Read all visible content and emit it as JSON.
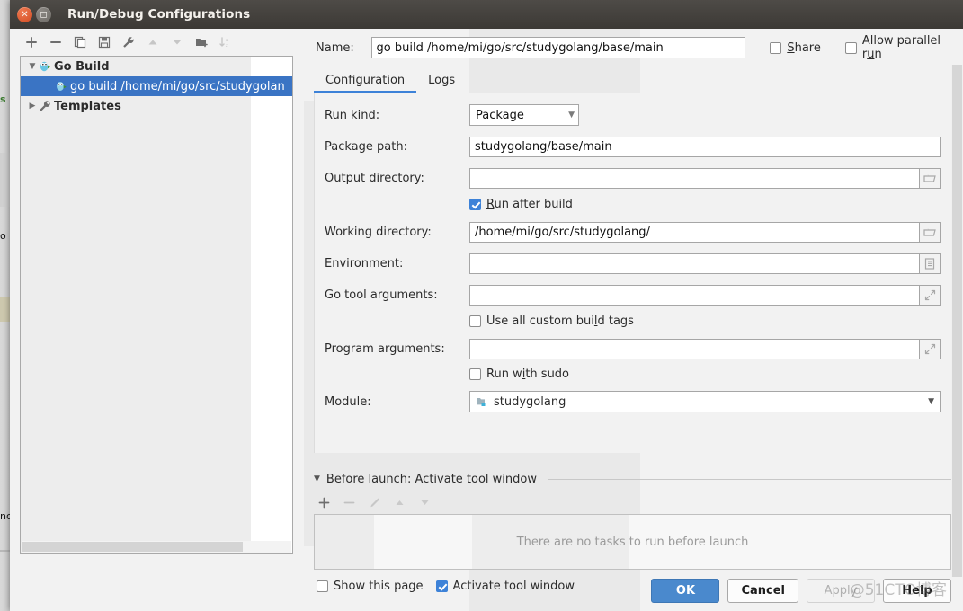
{
  "window": {
    "title": "Run/Debug Configurations",
    "close_icon": "close-icon",
    "maximize_icon": "maximize-icon"
  },
  "tree_toolbar": {
    "items": [
      {
        "icon": "plus-icon",
        "label": "+",
        "enabled": true
      },
      {
        "icon": "minus-icon",
        "label": "−",
        "enabled": true
      },
      {
        "icon": "copy-icon",
        "label": "Copy Configuration",
        "enabled": true
      },
      {
        "icon": "save-icon",
        "label": "Save Configuration",
        "enabled": true
      },
      {
        "icon": "wrench-icon",
        "label": "Edit Templates",
        "enabled": true
      },
      {
        "icon": "arrow-up-icon",
        "label": "Move Up",
        "enabled": false
      },
      {
        "icon": "arrow-down-icon",
        "label": "Move Down",
        "enabled": false
      },
      {
        "icon": "new-folder-icon",
        "label": "Create New Folder",
        "enabled": true
      },
      {
        "icon": "sort-alpha-icon",
        "label": "Sort Configurations",
        "enabled": false
      }
    ]
  },
  "tree": {
    "nodes": [
      {
        "label": "Go Build",
        "icon": "go-gopher-icon",
        "twisty": "▼",
        "level": 0,
        "selected": false
      },
      {
        "label": "go build /home/mi/go/src/studygolan",
        "icon": "go-run-icon",
        "twisty": "",
        "level": 1,
        "selected": true
      },
      {
        "label": "Templates",
        "icon": "wrench-icon",
        "twisty": "▶",
        "level": 0,
        "selected": false
      }
    ]
  },
  "name_row": {
    "label": "Name:",
    "value": "go build /home/mi/go/src/studygolang/base/main",
    "placeholder": "",
    "share": {
      "label": "Share",
      "mnemonic": "S",
      "checked": false
    },
    "allow_parallel": {
      "label": "Allow parallel run",
      "mnemonic": "u",
      "checked": false
    }
  },
  "tabs": [
    {
      "label": "Configuration",
      "active": true
    },
    {
      "label": "Logs",
      "active": false
    }
  ],
  "config": {
    "run_kind": {
      "label": "Run kind:",
      "value": "Package",
      "caret": "▼"
    },
    "package_path": {
      "label": "Package path:",
      "value": "studygolang/base/main",
      "spell_error": "studygolang"
    },
    "output_directory": {
      "label": "Output directory:",
      "value": "",
      "button_icon": "folder-icon"
    },
    "run_after_build": {
      "label": "Run after build",
      "mnemonic": "R",
      "checked": true
    },
    "working_directory": {
      "label": "Working directory:",
      "value": "/home/mi/go/src/studygolang/",
      "button_icon": "folder-icon"
    },
    "environment": {
      "label": "Environment:",
      "value": "",
      "button_icon": "list-edit-icon"
    },
    "go_tool_arguments": {
      "label": "Go tool arguments:",
      "value": "",
      "button_icon": "expand-icon"
    },
    "use_all_custom_build_tags": {
      "label": "Use all custom build tags",
      "mnemonic": "l",
      "checked": false
    },
    "program_arguments": {
      "label": "Program arguments:",
      "value": "",
      "button_icon": "expand-icon"
    },
    "run_with_sudo": {
      "label": "Run with sudo",
      "mnemonic": "i",
      "checked": false
    },
    "module": {
      "label": "Module:",
      "value": "studygolang",
      "icon": "module-icon",
      "caret": "▼"
    }
  },
  "before_launch": {
    "title": "Before launch: Activate tool window",
    "twisty": "▼",
    "toolbar": [
      {
        "icon": "plus-icon",
        "enabled": true
      },
      {
        "icon": "minus-icon",
        "enabled": false
      },
      {
        "icon": "pencil-icon",
        "enabled": false
      },
      {
        "icon": "arrow-up-icon",
        "enabled": false
      },
      {
        "icon": "arrow-down-icon",
        "enabled": false
      }
    ],
    "empty_text": "There are no tasks to run before launch",
    "show_this_page": {
      "label": "Show this page",
      "checked": false
    },
    "activate_tool_window": {
      "label": "Activate tool window",
      "checked": true
    }
  },
  "buttons": {
    "ok": "OK",
    "cancel": "Cancel",
    "apply": "Apply",
    "help": "Help"
  },
  "watermark": "@51CTO博客",
  "background_fragments": {
    "frag1": "s",
    "frag2": "o",
    "frag3": "nc"
  },
  "colors": {
    "accent": "#3d82d8",
    "selection": "#3a74c4",
    "primary_button": "#4a89cd",
    "titlebar": "#3c3935",
    "spell_underline": "#cf4b3b"
  }
}
